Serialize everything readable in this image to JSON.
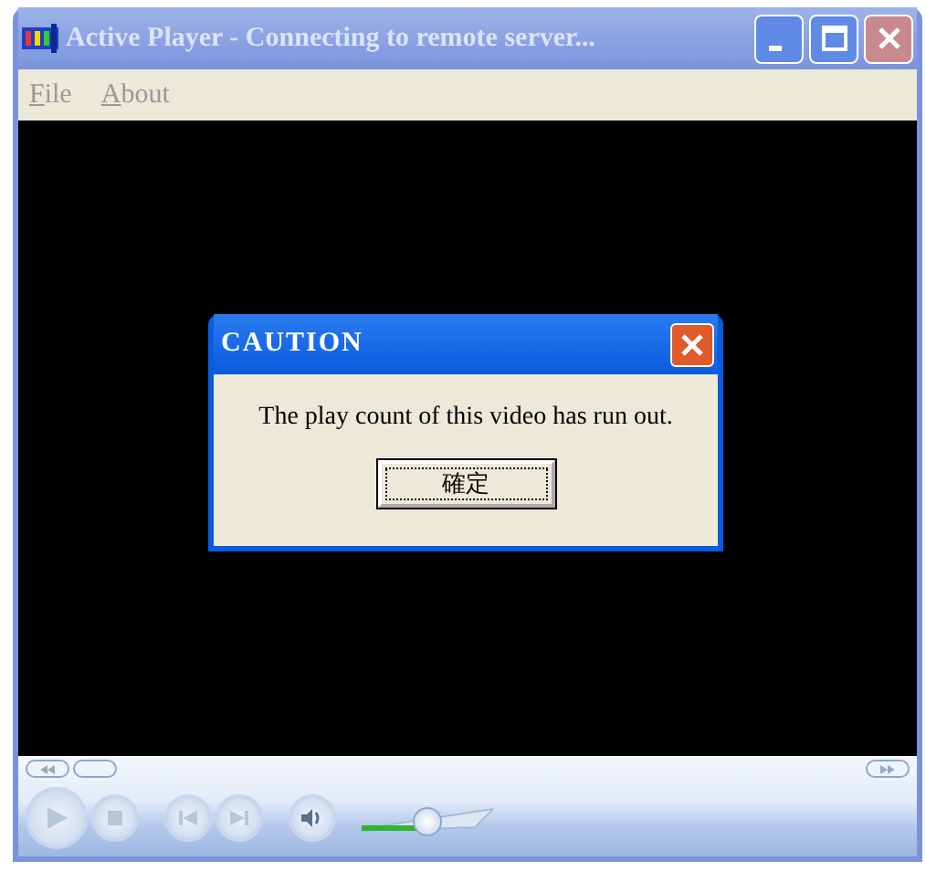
{
  "window": {
    "title": "Active Player - Connecting to remote server...",
    "active": false
  },
  "menu": [
    {
      "label": "File"
    },
    {
      "label": "About"
    }
  ],
  "dialog": {
    "title": "CAUTION",
    "message": "The play count of this video has run out.",
    "button": "確定"
  },
  "volume": {
    "level": 0.5
  }
}
